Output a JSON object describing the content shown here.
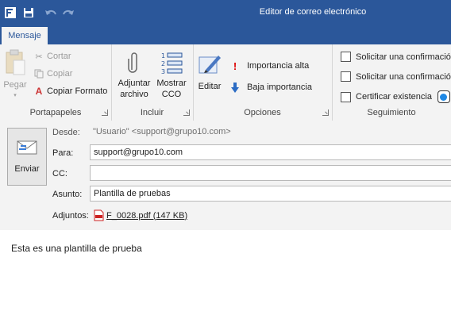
{
  "window": {
    "title": "Editor de correo electrónico"
  },
  "quick_access": [
    "app-icon",
    "save-icon",
    "undo-icon",
    "redo-icon"
  ],
  "tabs": [
    {
      "label": "Mensaje"
    }
  ],
  "ribbon": {
    "portapapeles": {
      "label": "Portapapeles",
      "pegar": "Pegar",
      "cortar": "Cortar",
      "copiar": "Copiar",
      "copiar_formato": "Copiar Formato"
    },
    "incluir": {
      "label": "Incluir",
      "adjuntar_line1": "Adjuntar",
      "adjuntar_line2": "archivo",
      "mostrar_line1": "Mostrar",
      "mostrar_line2": "CCO"
    },
    "opciones": {
      "label": "Opciones",
      "editar": "Editar",
      "importancia_alta": "Importancia alta",
      "baja_importancia": "Baja importancia"
    },
    "seguimiento": {
      "label": "Seguimiento",
      "check1": "Solicitar una confirmació",
      "check2": "Solicitar una confirmació",
      "check3": "Certificar existencia"
    }
  },
  "compose": {
    "send_label": "Enviar",
    "from_label": "Desde:",
    "from_value": "\"Usuario\" <support@grupo10.com>",
    "to_label": "Para:",
    "to_value": "support@grupo10.com",
    "cc_label": "CC:",
    "cc_value": "",
    "subject_label": "Asunto:",
    "subject_value": "Plantilla de pruebas",
    "attachments_label": "Adjuntos:",
    "attachment_name": "F_0028.pdf (147 KB)"
  },
  "body": {
    "text": "Esta es una plantilla de prueba"
  },
  "colors": {
    "titlebar": "#2b579a",
    "ribbon": "#f3f3f3",
    "toggle": "#1e88e5"
  }
}
